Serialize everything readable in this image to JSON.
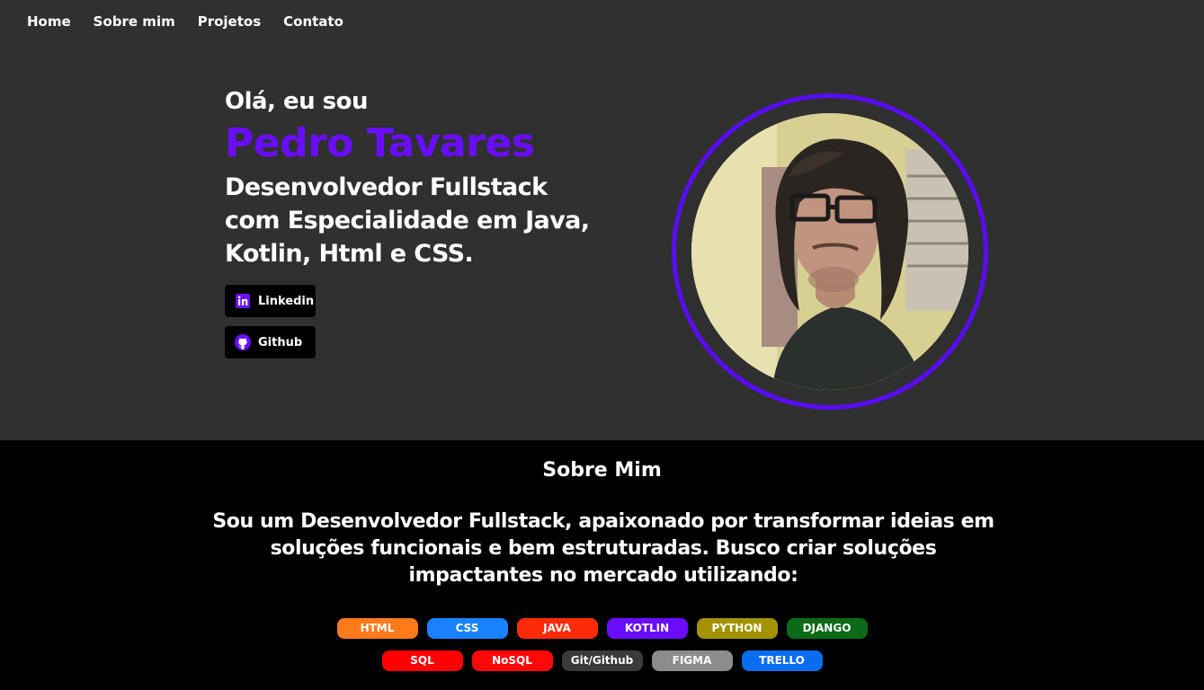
{
  "nav": {
    "items": [
      {
        "label": "Home"
      },
      {
        "label": "Sobre mim"
      },
      {
        "label": "Projetos"
      },
      {
        "label": "Contato"
      }
    ]
  },
  "hero": {
    "greeting": "Olá, eu sou",
    "name": "Pedro Tavares",
    "role_lines": [
      "Desenvolvedor Fullstack",
      "com Especialidade em Java,",
      "Kotlin, Html e CSS."
    ],
    "name_color": "#6a0dff",
    "ring_color": "#5a0cf6",
    "buttons": [
      {
        "label": "Linkedin",
        "icon": "linkedin-icon"
      },
      {
        "label": "Github",
        "icon": "github-icon"
      }
    ],
    "photo": {
      "icon": "profile-photo"
    }
  },
  "about": {
    "title": "Sobre Mim",
    "text": "Sou um Desenvolvedor Fullstack, apaixonado por transformar ideias em soluções funcionais e bem estruturadas. Busco criar soluções impactantes no mercado utilizando:",
    "skills_row1": [
      {
        "label": "HTML",
        "color": "#ff7a1a"
      },
      {
        "label": "CSS",
        "color": "#1a82ff"
      },
      {
        "label": "JAVA",
        "color": "#ff2a0a"
      },
      {
        "label": "KOTLIN",
        "color": "#6a0dff"
      },
      {
        "label": "PYTHON",
        "color": "#a39300"
      },
      {
        "label": "DJANGO",
        "color": "#0b6b16"
      }
    ],
    "skills_row2": [
      {
        "label": "SQL",
        "color": "#ff0000"
      },
      {
        "label": "NoSQL",
        "color": "#ff0808"
      },
      {
        "label": "Git/Github",
        "color": "#3a3a3a"
      },
      {
        "label": "FIGMA",
        "color": "#8c8c8c"
      },
      {
        "label": "TRELLO",
        "color": "#0a6cf0"
      }
    ]
  }
}
